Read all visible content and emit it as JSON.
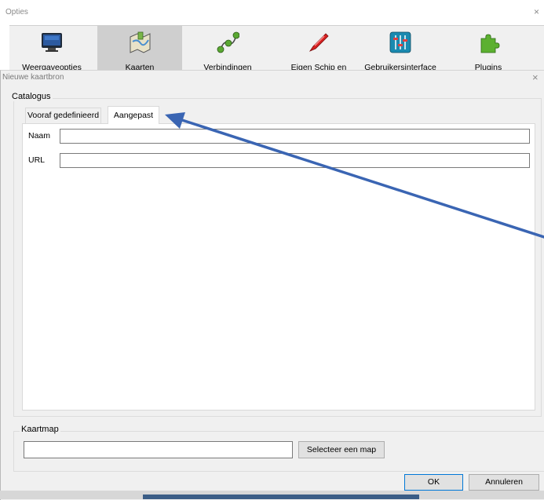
{
  "options_window": {
    "title": "Opties",
    "close_glyph": "×",
    "toolbar": [
      {
        "label": "Weergaveopties",
        "icon": "monitor-icon",
        "selected": false
      },
      {
        "label": "Kaarten",
        "icon": "charts-icon",
        "selected": true
      },
      {
        "label": "Verbindingen",
        "icon": "connections-icon",
        "selected": false
      },
      {
        "label": "Eigen Schip en",
        "icon": "ship-icon",
        "selected": false
      },
      {
        "label": "Gebruikersinterface",
        "icon": "sliders-icon",
        "selected": false
      },
      {
        "label": "Plugins",
        "icon": "puzzle-icon",
        "selected": false
      }
    ]
  },
  "dialog": {
    "title": "Nieuwe kaartbron",
    "close_glyph": "×",
    "catalog_group": {
      "legend": "Catalogus",
      "tabs": [
        {
          "label": "Vooraf gedefinieerd",
          "active": false
        },
        {
          "label": "Aangepast",
          "active": true
        }
      ],
      "fields": {
        "name": {
          "label": "Naam",
          "value": ""
        },
        "url": {
          "label": "URL",
          "value": ""
        }
      }
    },
    "folder_group": {
      "legend": "Kaartmap",
      "path_value": "",
      "select_button": "Selecteer een map"
    },
    "buttons": {
      "ok": "OK",
      "cancel": "Annuleren"
    }
  },
  "annotation": {
    "arrow_color": "#3a65b3",
    "points_to": "tab-custom"
  },
  "colors": {
    "dialog_bg": "#f0f0f0",
    "selected_tool_bg": "#cfcfcf",
    "ok_border": "#0078d7"
  }
}
